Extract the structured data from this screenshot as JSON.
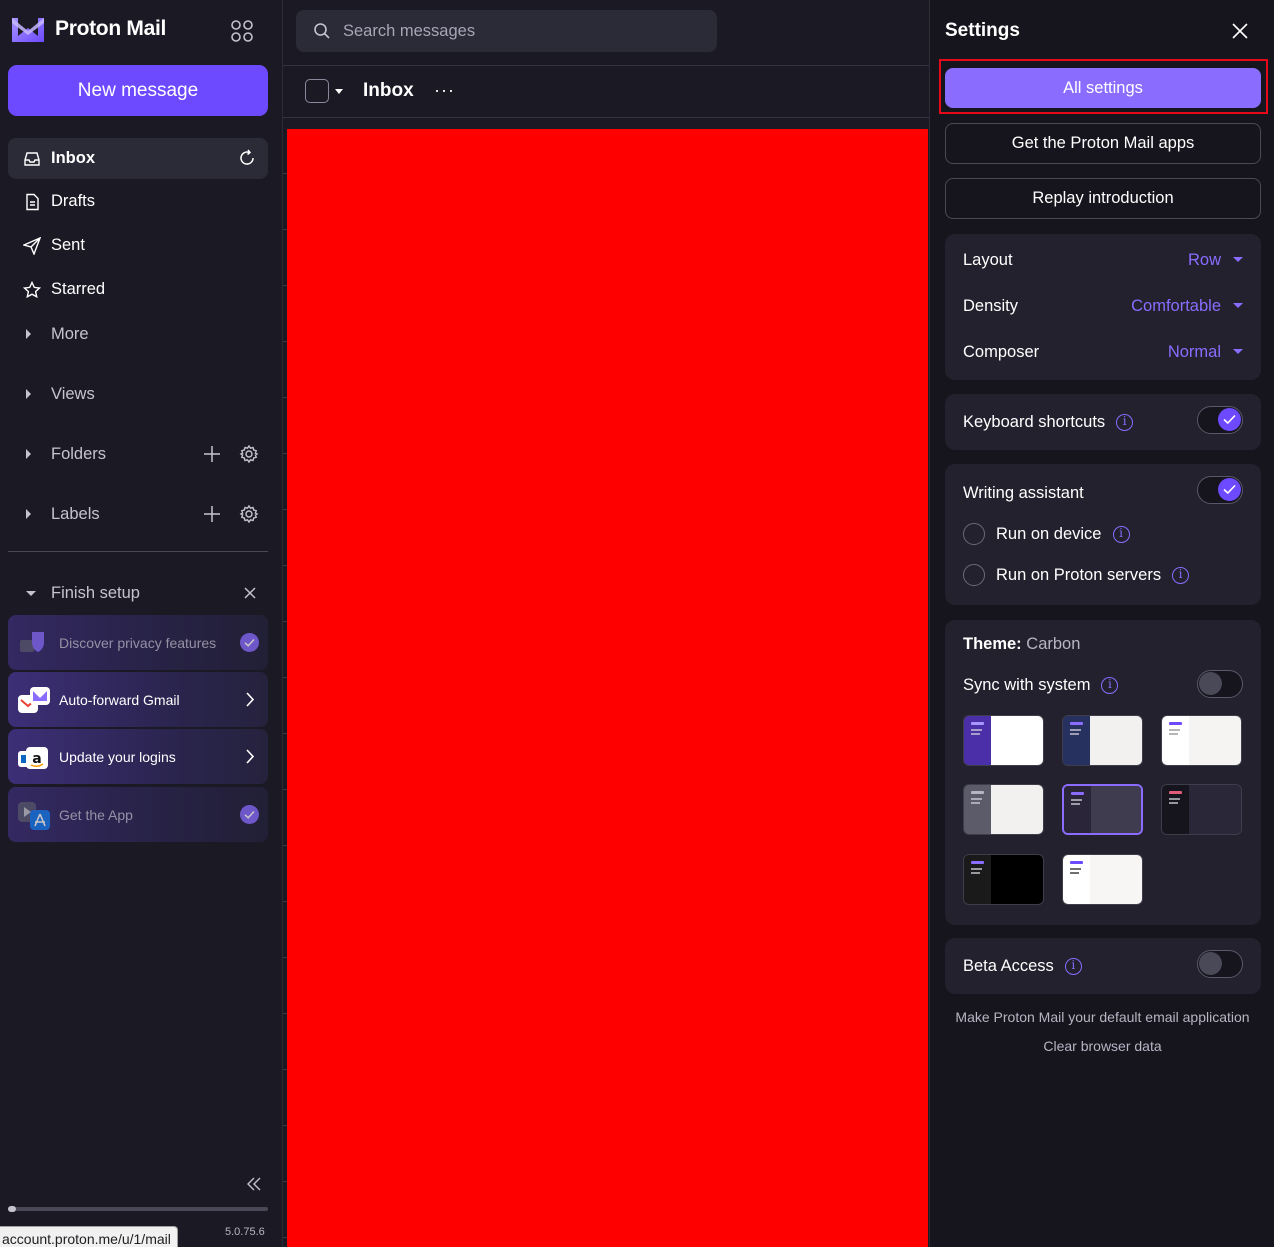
{
  "brand": {
    "name": "Proton Mail"
  },
  "sidebar": {
    "new_message": "New message",
    "items": [
      {
        "label": "Inbox",
        "icon": "inbox-icon"
      },
      {
        "label": "Drafts",
        "icon": "file-icon"
      },
      {
        "label": "Sent",
        "icon": "paper-plane-icon"
      },
      {
        "label": "Starred",
        "icon": "star-icon"
      }
    ],
    "groups": {
      "more": "More",
      "views": "Views",
      "folders": "Folders",
      "labels": "Labels"
    },
    "finish_setup": {
      "title": "Finish setup",
      "items": [
        {
          "label": "Discover privacy features",
          "done": true
        },
        {
          "label": "Auto-forward Gmail",
          "done": false
        },
        {
          "label": "Update your logins",
          "done": false
        },
        {
          "label": "Get the App",
          "done": true
        }
      ]
    },
    "status_url": "account.proton.me/u/1/mail",
    "version": "5.0.75.6"
  },
  "search": {
    "placeholder": "Search messages"
  },
  "list_header": {
    "title": "Inbox",
    "more": "···"
  },
  "settings": {
    "title": "Settings",
    "all_settings": "All settings",
    "get_apps": "Get the Proton Mail apps",
    "replay_intro": "Replay introduction",
    "layout": {
      "label": "Layout",
      "value": "Row"
    },
    "density": {
      "label": "Density",
      "value": "Comfortable"
    },
    "composer": {
      "label": "Composer",
      "value": "Normal"
    },
    "keyboard_shortcuts": {
      "label": "Keyboard shortcuts",
      "enabled": true
    },
    "writing_assistant": {
      "label": "Writing assistant",
      "enabled": true,
      "run_on_device": "Run on device",
      "run_on_servers": "Run on Proton servers"
    },
    "theme": {
      "label": "Theme:",
      "value": "Carbon",
      "sync_label": "Sync with system",
      "sync_enabled": false,
      "selected_index": 4
    },
    "beta_access": {
      "label": "Beta Access",
      "enabled": false
    },
    "default_app_link": "Make Proton Mail your default email application",
    "clear_data_link": "Clear browser data"
  },
  "colors": {
    "accent": "#6d4aff",
    "accent_light": "#8a6cff",
    "background": "#1b1a24",
    "panel": "#16141c",
    "highlight": "#e5091a",
    "redacted": "#ff0000"
  }
}
